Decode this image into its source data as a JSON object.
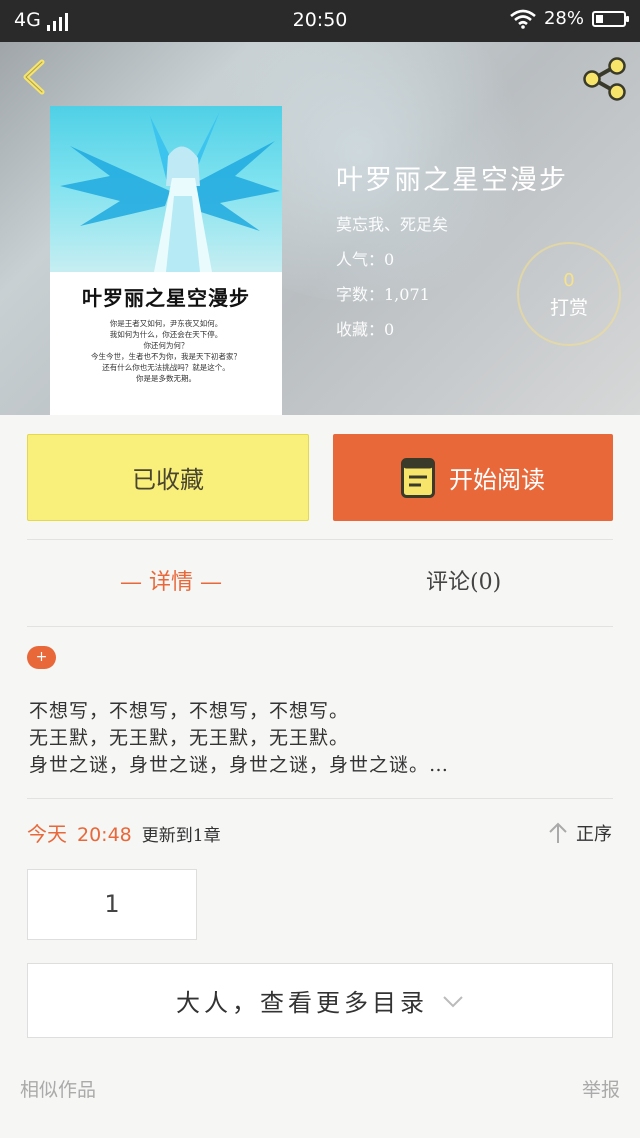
{
  "status_bar": {
    "network": "4G",
    "time": "20:50",
    "battery_percent": "28%",
    "battery_level": 0.28
  },
  "book": {
    "title": "叶罗丽之星空漫步",
    "author": "莫忘我、死足矣",
    "popularity": "人气：0",
    "word_count": "字数：1,071",
    "favorites": "收藏：0",
    "reward_count": "0",
    "reward_label": "打赏",
    "cover_title": "叶罗丽之星空漫步",
    "cover_blurb": [
      "你是王者又如何，尹东夜又如何。",
      "我如何为什么，你还会在天下停。",
      "你还何为何？",
      "今生今世，生者也不为你，我是天下初者家？",
      "还有什么你也无法挑战吗？就是这个。",
      "你是是多数无期。"
    ]
  },
  "actions": {
    "favorite_label": "已收藏",
    "read_label": "开始阅读"
  },
  "tabs": {
    "detail": "— 详情 —",
    "comments": "评论(0)"
  },
  "description": [
    "不想写，不想写，不想写，不想写。",
    "无王默，无王默，无王默，无王默。",
    "身世之谜，身世之谜，身世之谜，身世之谜。…"
  ],
  "update": {
    "day": "今天",
    "time": "20:48",
    "text": "更新到1章",
    "sort_label": "正序"
  },
  "chapters": {
    "current": "1",
    "more_label": "大人，查看更多目录"
  },
  "footer": {
    "similar": "相似作品",
    "report": "举报"
  },
  "colors": {
    "accent": "#e8683a",
    "favorite_bg": "#f8f07a",
    "icon_yellow": "#f7e46a"
  }
}
